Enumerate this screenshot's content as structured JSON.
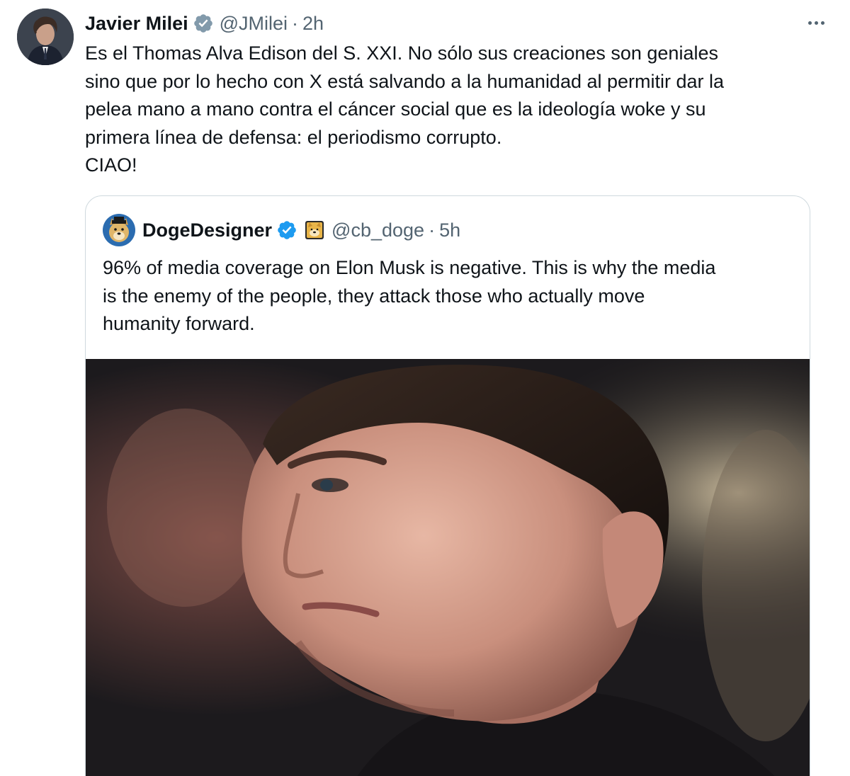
{
  "tweet": {
    "author_name": "Javier Milei",
    "handle": "@JMilei",
    "separator": "·",
    "time": "2h",
    "verified_icon": "verified-badge-gray",
    "more_icon": "more-options-icon",
    "body_lines": [
      "Es el Thomas Alva Edison del S. XXI. No sólo sus creaciones son geniales",
      "sino que por lo hecho con X está salvando a la humanidad al permitir dar la",
      "pelea mano a mano contra el cáncer social que es la ideología woke y su",
      "primera línea de defensa: el periodismo corrupto.",
      "CIAO!"
    ]
  },
  "quote": {
    "author_name": "DogeDesigner",
    "verified_icon": "verified-badge-blue",
    "emoji_icon": "doge-emoji",
    "handle": "@cb_doge",
    "separator": "·",
    "time": "5h",
    "body_lines": [
      "96% of media coverage on Elon Musk is negative. This is why the media",
      "is the enemy of the people, they attack those who actually move",
      "humanity forward."
    ],
    "media_icon": "portrait-photo"
  },
  "colors": {
    "text_primary": "#0f1419",
    "text_secondary": "#536471",
    "border": "#cfd9de",
    "verified_blue": "#1d9bf0",
    "verified_gray": "#829aab"
  }
}
